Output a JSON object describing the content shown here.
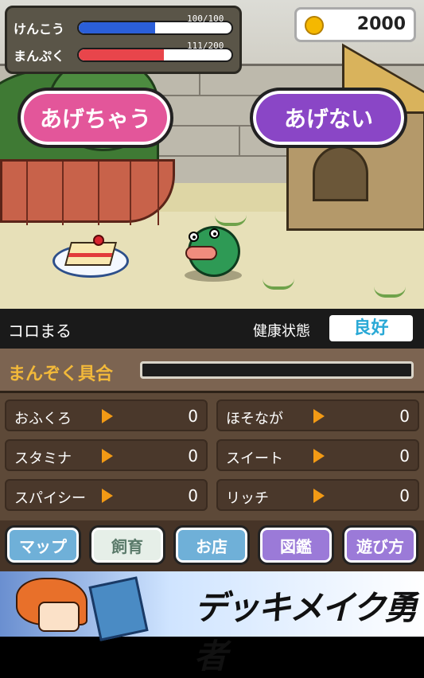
{
  "stats": {
    "health_label": "けんこう",
    "health_text": "100/100",
    "health_fraction": 0.5,
    "fullness_label": "まんぷく",
    "fullness_text": "111/200",
    "fullness_fraction": 0.555
  },
  "coins": {
    "amount": "2000"
  },
  "actions": {
    "give_label": "あげちゃう",
    "no_give_label": "あげない"
  },
  "pet": {
    "name": "コロまる",
    "health_status_label": "健康状態",
    "health_status_value": "良好"
  },
  "satisfaction": {
    "label": "まんぞく具合",
    "fraction": 0
  },
  "flavors": [
    {
      "label": "おふくろ",
      "value": "0"
    },
    {
      "label": "ほそなが",
      "value": "0"
    },
    {
      "label": "スタミナ",
      "value": "0"
    },
    {
      "label": "スイート",
      "value": "0"
    },
    {
      "label": "スパイシー",
      "value": "0"
    },
    {
      "label": "リッチ",
      "value": "0"
    }
  ],
  "nav": [
    {
      "label": "マップ",
      "color": "#6fb0d8"
    },
    {
      "label": "飼育",
      "color": "#e6efe8",
      "active": true
    },
    {
      "label": "お店",
      "color": "#6fb0d8"
    },
    {
      "label": "図鑑",
      "color": "#9b7ad8"
    },
    {
      "label": "遊び方",
      "color": "#9b7ad8"
    }
  ],
  "banner": {
    "title": "デッキメイク勇者"
  },
  "colors": {
    "health_bar": "#2b5fd9",
    "fullness_bar": "#e8454b",
    "give_button": "#e3569a",
    "no_give_button": "#8a46c6",
    "health_status_text": "#2aa9d6",
    "satisfaction_label": "#f2b93a"
  }
}
